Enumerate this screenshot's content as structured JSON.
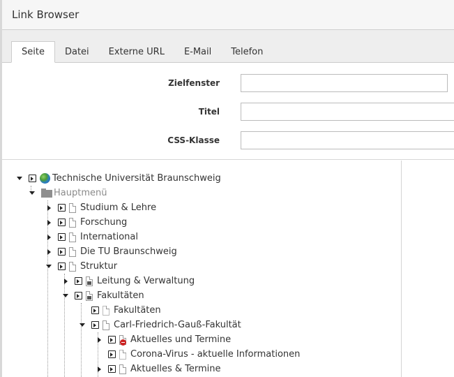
{
  "dialog": {
    "title": "Link Browser",
    "tabs": [
      {
        "label": "Seite",
        "active": true
      },
      {
        "label": "Datei",
        "active": false
      },
      {
        "label": "Externe URL",
        "active": false
      },
      {
        "label": "E-Mail",
        "active": false
      },
      {
        "label": "Telefon",
        "active": false
      }
    ]
  },
  "form": {
    "target_label": "Zielfenster",
    "target_value": "",
    "title_label": "Titel",
    "title_value": "",
    "css_label": "CSS-Klasse",
    "css_value": ""
  },
  "tree": {
    "nodes": [
      {
        "label": "Technische Universität Braunschweig",
        "icon": "globe-icon",
        "expanded": true
      },
      {
        "label": "Hauptmenü",
        "icon": "folder-icon",
        "expanded": true
      },
      {
        "label": "Studium & Lehre",
        "icon": "page-icon",
        "expanded": false
      },
      {
        "label": "Forschung",
        "icon": "page-icon",
        "expanded": false
      },
      {
        "label": "International",
        "icon": "page-icon",
        "expanded": false
      },
      {
        "label": "Die TU Braunschweig",
        "icon": "page-icon",
        "expanded": false
      },
      {
        "label": "Struktur",
        "icon": "page-icon",
        "expanded": true
      },
      {
        "label": "Leitung & Verwaltung",
        "icon": "shortcut-page-icon",
        "expanded": false
      },
      {
        "label": "Fakultäten",
        "icon": "shortcut-page-icon",
        "expanded": true
      },
      {
        "label": "Fakultäten",
        "icon": "page-icon",
        "expanded": null
      },
      {
        "label": "Carl-Friedrich-Gauß-Fakultät",
        "icon": "page-icon",
        "expanded": true
      },
      {
        "label": "Aktuelles und Termine",
        "icon": "hidden-page-icon",
        "expanded": false
      },
      {
        "label": "Corona-Virus - aktuelle Informationen",
        "icon": "page-icon",
        "expanded": null
      },
      {
        "label": "Aktuelles & Termine",
        "icon": "page-icon",
        "expanded": false
      }
    ]
  }
}
